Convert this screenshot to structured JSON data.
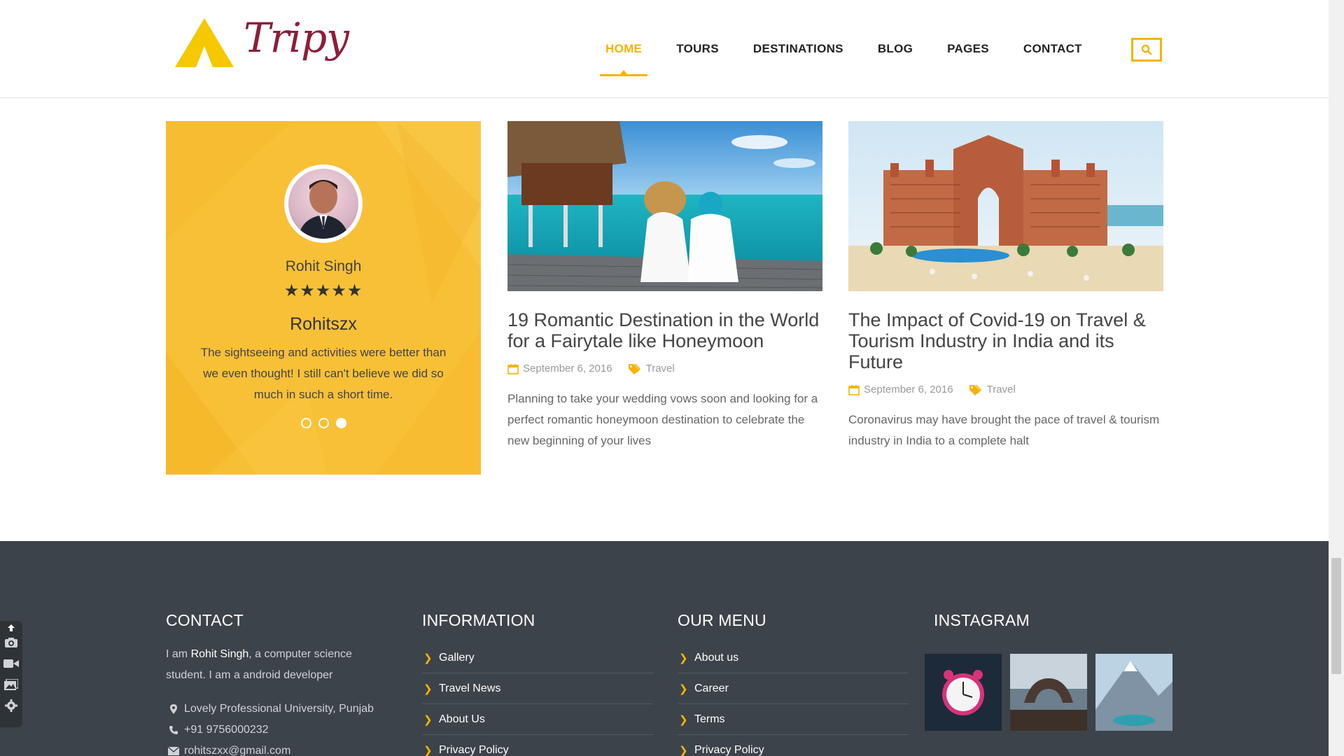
{
  "header": {
    "logo_text": "Tripy",
    "nav": [
      {
        "label": "HOME",
        "active": true
      },
      {
        "label": "TOURS",
        "active": false
      },
      {
        "label": "DESTINATIONS",
        "active": false
      },
      {
        "label": "BLOG",
        "active": false
      },
      {
        "label": "PAGES",
        "active": false
      },
      {
        "label": "CONTACT",
        "active": false
      }
    ],
    "search_icon": "search-icon"
  },
  "testimonial": {
    "name": "Rohit Singh",
    "stars": "★★★★★",
    "rating": 5,
    "handle": "Rohitszx",
    "quote": "The sightseeing and activities were better than we even thought! I still can't believe we did so much in such a short time.",
    "slides": 3,
    "active_slide": 3
  },
  "posts": [
    {
      "title": "19 Romantic Destination in the World for a Fairytale like Honeymoon",
      "date": "September 6, 2016",
      "category": "Travel",
      "excerpt": "Planning to take your wedding vows soon and looking for a perfect romantic honeymoon destination to celebrate the new beginning of your lives"
    },
    {
      "title": "The Impact of Covid-19 on Travel & Tourism Industry in India and its Future",
      "date": "September 6, 2016",
      "category": "Travel",
      "excerpt": "Coronavirus may have brought the pace of travel & tourism industry in India to a complete halt"
    }
  ],
  "footer": {
    "contact": {
      "heading": "CONTACT",
      "intro_pre": "I am ",
      "intro_name": "Rohit Singh",
      "intro_post": ", a computer science student. I am a android developer",
      "address": "Lovely Professional University, Punjab",
      "phone": "+91 9756000232",
      "email": "rohitszxx@gmail.com"
    },
    "information": {
      "heading": "INFORMATION",
      "items": [
        "Gallery",
        "Travel News",
        "About Us",
        "Privacy Policy"
      ]
    },
    "menu": {
      "heading": "OUR MENU",
      "items": [
        "About us",
        "Career",
        "Terms",
        "Privacy Policy"
      ]
    },
    "instagram": {
      "heading": "INSTAGRAM"
    }
  },
  "colors": {
    "accent": "#f5b400",
    "testimonial_bg": "#f8c037",
    "footer_bg": "#3d434a",
    "logo": "#8f1d3a"
  }
}
